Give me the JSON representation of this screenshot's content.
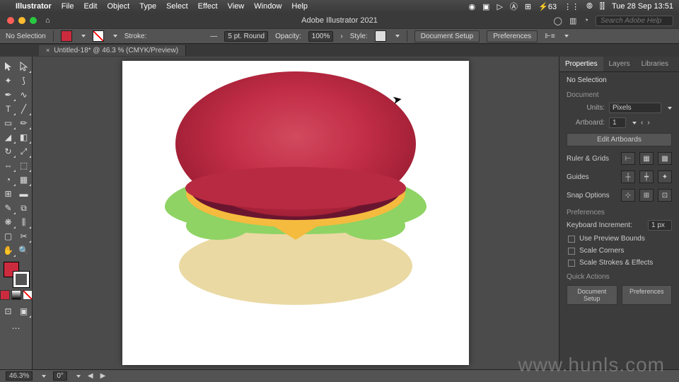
{
  "menubar": {
    "app": "Illustrator",
    "items": [
      "File",
      "Edit",
      "Object",
      "Type",
      "Select",
      "Effect",
      "View",
      "Window",
      "Help"
    ],
    "clock": "Tue 28 Sep  13:51"
  },
  "titlebar": {
    "title": "Adobe Illustrator 2021",
    "search_placeholder": "Search Adobe Help"
  },
  "optbar": {
    "selection": "No Selection",
    "fill_color": "#cc2b3e",
    "stroke_label": "Stroke:",
    "stroke_weight": "5 pt. Round",
    "opacity_label": "Opacity:",
    "opacity_value": "100%",
    "style_label": "Style:",
    "doc_setup": "Document Setup",
    "preferences": "Preferences"
  },
  "tab": {
    "label": "Untitled-18* @ 46.3 % (CMYK/Preview)"
  },
  "panel": {
    "tabs": [
      "Properties",
      "Layers",
      "Libraries"
    ],
    "no_selection": "No Selection",
    "document": "Document",
    "units_label": "Units:",
    "units_value": "Pixels",
    "artboard_label": "Artboard:",
    "artboard_value": "1",
    "edit_artboards": "Edit Artboards",
    "ruler_grids": "Ruler & Grids",
    "guides": "Guides",
    "snap_options": "Snap Options",
    "preferences_h": "Preferences",
    "kb_incr_label": "Keyboard Increment:",
    "kb_incr_value": "1 px",
    "use_preview": "Use Preview Bounds",
    "scale_corners": "Scale Corners",
    "scale_strokes": "Scale Strokes & Effects",
    "quick_actions": "Quick Actions",
    "qa_doc_setup": "Document Setup",
    "qa_prefs": "Preferences"
  },
  "status": {
    "zoom": "46.3%",
    "rotate": "0°"
  },
  "watermark": "www.hunls.com",
  "burger_colors": {
    "bun_top": "#c32e47",
    "patty": "#6a1530",
    "cheese": "#f4bb3e",
    "lettuce": "#8ed364",
    "bun_bottom": "#ead9a3"
  }
}
